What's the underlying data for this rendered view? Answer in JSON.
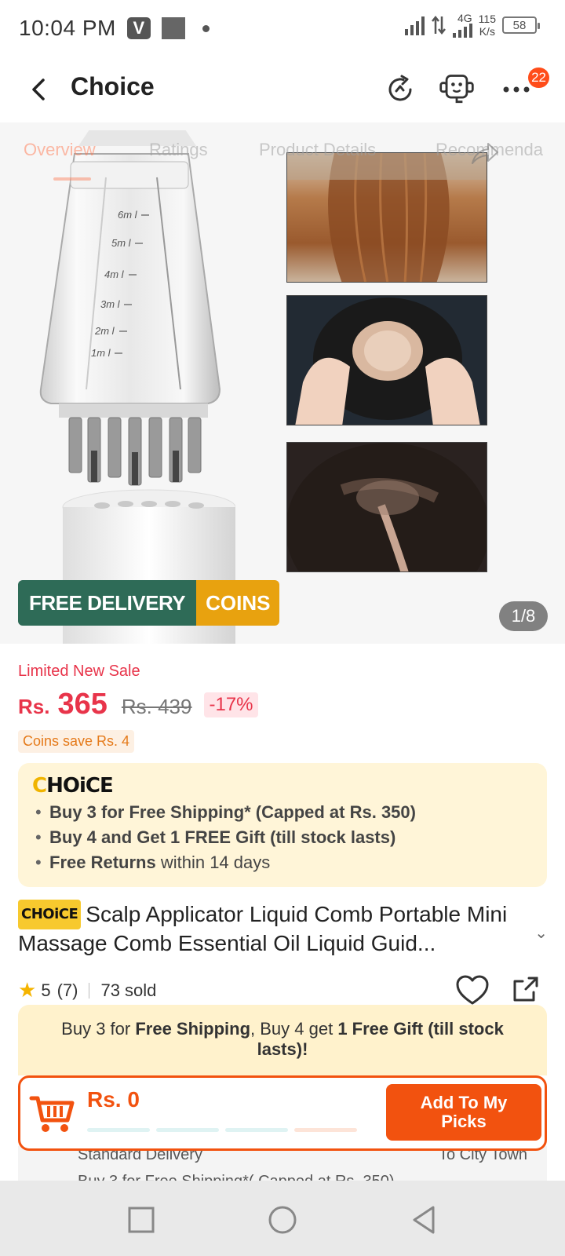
{
  "status": {
    "time": "10:04 PM",
    "v_badge": "V",
    "net_type": "4G",
    "speed_value": "115",
    "speed_unit": "K/s",
    "battery": "58"
  },
  "header": {
    "title": "Choice",
    "more_badge": "22",
    "icons": [
      "back-icon",
      "refresh-icon",
      "support-icon",
      "more-icon"
    ]
  },
  "gallery": {
    "tabs": [
      "Overview",
      "Ratings",
      "Product Details",
      "Recommenda"
    ],
    "active_tab": 0,
    "promo_free": "FREE DELIVERY",
    "promo_coins": "COINS",
    "page_indicator": "1/8",
    "bottle_marks": [
      "6m l",
      "5m l",
      "4m l",
      "3m l",
      "2m l",
      "1m l"
    ]
  },
  "price": {
    "sale_label": "Limited New Sale",
    "currency": "Rs.",
    "current": "365",
    "original": "Rs. 439",
    "discount": "-17%",
    "coins_save": "Coins save Rs. 4"
  },
  "choice": {
    "logo_prefix": "C",
    "logo_rest": "HOiCE",
    "lines": [
      {
        "bold": "Buy 3 for  Free Shipping* (Capped at Rs. 350)",
        "rest": ""
      },
      {
        "bold": "Buy 4 and Get 1 FREE Gift (till stock lasts)",
        "rest": ""
      },
      {
        "bold": "Free Returns",
        "rest": " within 14 days"
      }
    ]
  },
  "product": {
    "tag": "CHOiCE",
    "title": "Scalp Applicator Liquid Comb Portable Mini Massage Comb Essential Oil Liquid Guid...",
    "rating": "5",
    "reviews": "(7)",
    "sold": "73 sold"
  },
  "ship_note": {
    "prefix": "Buy 3 for ",
    "free_shipping": "Free Shipping",
    "middle": ", Buy 4 get ",
    "gift": "1 Free Gift (till stock lasts)!"
  },
  "under": {
    "standard": "Standard Delivery",
    "city": "To City Town",
    "line2": "Buy 3 for Free Shipping*( Capped at Rs. 350)"
  },
  "cart": {
    "total": "Rs. 0",
    "add_label_1": "Add To My",
    "add_label_2": "Picks",
    "progress_segments": 4
  },
  "colors": {
    "accent": "#f2520f",
    "sale_red": "#e8344a",
    "choice_bg": "#fff5d8",
    "promo_green": "#2e6b57",
    "promo_gold": "#e8a20f"
  }
}
